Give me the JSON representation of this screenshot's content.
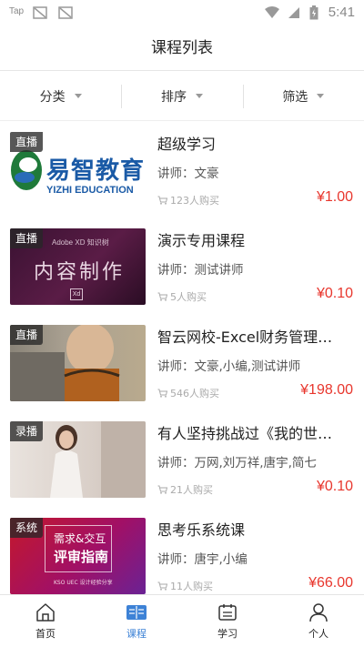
{
  "status": {
    "carrier": "Tap",
    "time": "5:41"
  },
  "header": {
    "title": "课程列表"
  },
  "filters": [
    {
      "label": "分类"
    },
    {
      "label": "排序"
    },
    {
      "label": "筛选"
    }
  ],
  "courses": [
    {
      "tag": "直播",
      "title": "超级学习",
      "teacher": "讲师：文豪",
      "buyers": "123人购买",
      "price": "¥1.00",
      "thumb": {
        "logo_cn": "易智教育",
        "logo_en": "YIZHI EDUCATION"
      }
    },
    {
      "tag": "直播",
      "title": "演示专用课程",
      "teacher": "讲师：测试讲师",
      "buyers": "5人购买",
      "price": "¥0.10",
      "thumb": {
        "top_text": "Adobe XD 知识树",
        "big_text": "内容制作",
        "badge": "Xd"
      }
    },
    {
      "tag": "直播",
      "title": "智云网校-Excel财务管理…",
      "teacher": "讲师：文豪,小编,测试讲师",
      "buyers": "546人购买",
      "price": "¥198.00"
    },
    {
      "tag": "录播",
      "title": "有人坚持挑战过《我的世…",
      "teacher": "讲师：万网,刘万祥,唐宇,简七",
      "buyers": "21人购买",
      "price": "¥0.10"
    },
    {
      "tag": "系统",
      "title": "思考乐系统课",
      "teacher": "讲师：唐宇,小编",
      "buyers": "11人购买",
      "price": "¥66.00",
      "thumb": {
        "line1": "需求&交互",
        "line2": "评审指南",
        "footer": "KSO UEC 设计经验分享"
      }
    }
  ],
  "tabs": [
    {
      "label": "首页",
      "icon": "home-icon",
      "active": false
    },
    {
      "label": "课程",
      "icon": "course-icon",
      "active": true
    },
    {
      "label": "学习",
      "icon": "study-icon",
      "active": false
    },
    {
      "label": "个人",
      "icon": "person-icon",
      "active": false
    }
  ],
  "colors": {
    "accent": "#3d82d6",
    "price": "#e8362d"
  }
}
